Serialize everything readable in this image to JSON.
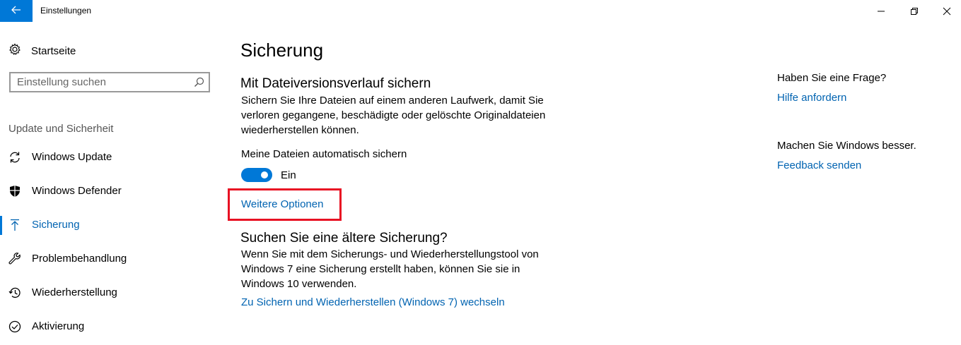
{
  "window": {
    "title": "Einstellungen",
    "accent": "#0078d7"
  },
  "sidebar": {
    "home_label": "Startseite",
    "search_placeholder": "Einstellung suchen",
    "section_title": "Update und Sicherheit",
    "items": [
      {
        "label": "Windows Update",
        "icon": "refresh-icon"
      },
      {
        "label": "Windows Defender",
        "icon": "shield-icon"
      },
      {
        "label": "Sicherung",
        "icon": "backup-arrow-icon",
        "active": true
      },
      {
        "label": "Problembehandlung",
        "icon": "wrench-icon"
      },
      {
        "label": "Wiederherstellung",
        "icon": "history-icon"
      },
      {
        "label": "Aktivierung",
        "icon": "check-circle-icon"
      }
    ]
  },
  "main": {
    "title": "Sicherung",
    "file_history": {
      "heading": "Mit Dateiversionsverlauf sichern",
      "description": "Sichern Sie Ihre Dateien auf einem anderen Laufwerk, damit Sie verloren gegangene, beschädigte oder gelöschte Originaldateien wiederherstellen können.",
      "auto_backup_label": "Meine Dateien automatisch sichern",
      "toggle_state": "Ein",
      "more_options_link": "Weitere Optionen"
    },
    "older_backup": {
      "heading": "Suchen Sie eine ältere Sicherung?",
      "description": "Wenn Sie mit dem Sicherungs- und Wiederherstellungstool von Windows 7 eine Sicherung erstellt haben, können Sie sie in Windows 10 verwenden.",
      "switch_link": "Zu Sichern und Wiederherstellen (Windows 7) wechseln"
    }
  },
  "aside": {
    "question": "Haben Sie eine Frage?",
    "help_link": "Hilfe anfordern",
    "improve": "Machen Sie Windows besser.",
    "feedback_link": "Feedback senden"
  },
  "highlight_color": "#e81123"
}
